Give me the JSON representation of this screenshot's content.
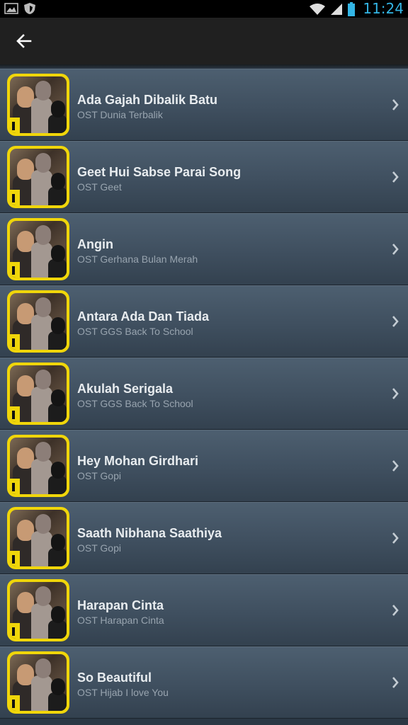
{
  "status_bar": {
    "time": "11:24",
    "left_icons": [
      "image-icon",
      "shield-icon"
    ],
    "right_icons": [
      "wifi-icon",
      "signal-icon",
      "battery-icon"
    ],
    "clock_color": "#33b5e5"
  },
  "app_bar": {
    "back_icon": "arrow-left-icon"
  },
  "songs": [
    {
      "title": "Ada Gajah Dibalik Batu",
      "subtitle": "OST Dunia Terbalik"
    },
    {
      "title": "Geet Hui Sabse Parai Song",
      "subtitle": "OST Geet"
    },
    {
      "title": "Angin",
      "subtitle": "OST Gerhana Bulan Merah"
    },
    {
      "title": "Antara Ada Dan Tiada",
      "subtitle": "OST GGS Back To School"
    },
    {
      "title": "Akulah Serigala",
      "subtitle": "OST GGS Back To School"
    },
    {
      "title": "Hey Mohan Girdhari",
      "subtitle": "OST Gopi"
    },
    {
      "title": "Saath Nibhana Saathiya",
      "subtitle": "OST Gopi"
    },
    {
      "title": "Harapan Cinta",
      "subtitle": "OST Harapan Cinta"
    },
    {
      "title": "So Beautiful",
      "subtitle": "OST Hijab I love You"
    }
  ],
  "colors": {
    "accent_yellow": "#f0d60a",
    "row_background": "#3f4f5f",
    "app_bar": "#202020"
  }
}
